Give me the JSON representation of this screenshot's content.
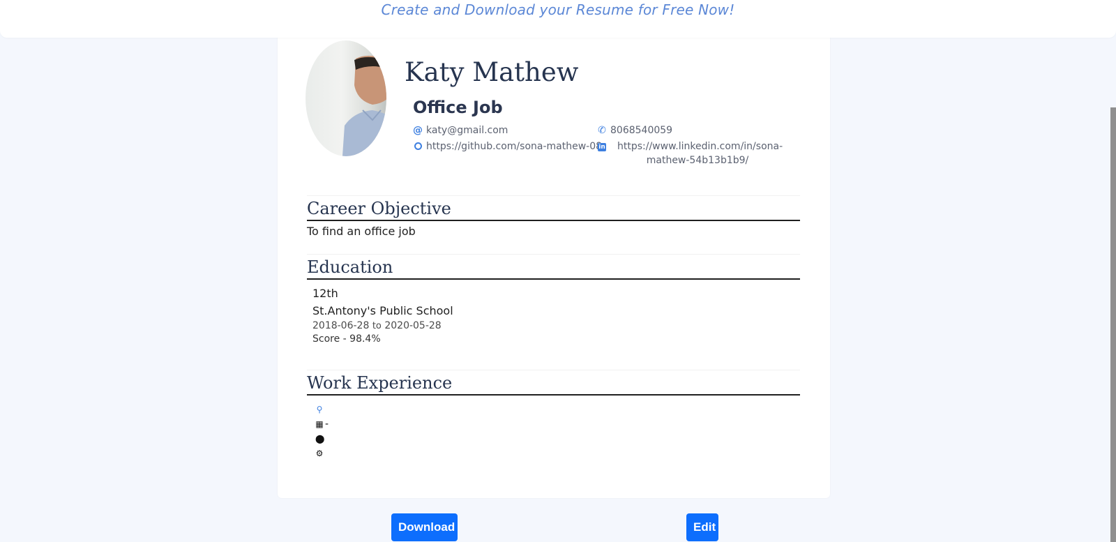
{
  "header": {
    "tagline": "Create and Download your Resume for Free Now!"
  },
  "profile": {
    "name": "Katy Mathew",
    "role": "Office Job",
    "email": "katy@gmail.com",
    "phone": "8068540059",
    "github": "https://github.com/sona-mathew-08",
    "linkedin": "https://www.linkedin.com/in/sona-mathew-54b13b1b9/",
    "icons": {
      "email": "at-icon",
      "phone": "phone-icon",
      "github": "github-icon",
      "linkedin": "linkedin-icon"
    },
    "accent_color": "#3d7fe0"
  },
  "sections": {
    "career": {
      "title": "Career Objective",
      "text": "To find an office job"
    },
    "education": {
      "title": "Education",
      "items": [
        {
          "degree": "12th",
          "school": "St.Antony's Public School",
          "start": "2018-06-28",
          "to": "to",
          "end": "2020-05-28",
          "score": "Score - 98.4%"
        }
      ]
    },
    "work": {
      "title": "Work Experience",
      "link": "",
      "date_sep": "-",
      "location": "",
      "description": ""
    }
  },
  "actions": {
    "download": "Download",
    "edit": "Edit",
    "button_color": "#0d6efd"
  }
}
